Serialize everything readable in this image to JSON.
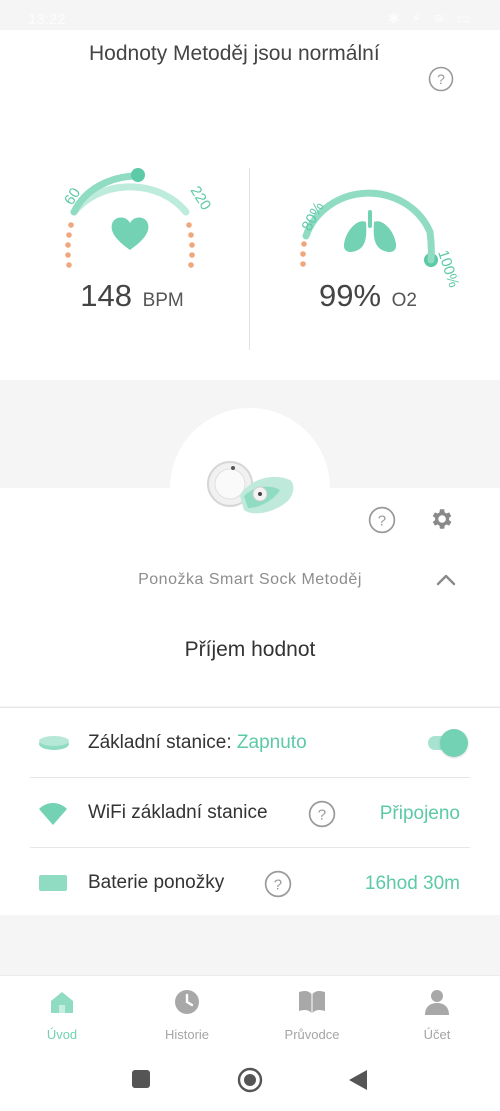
{
  "status_bar": {
    "time": "13:22",
    "icons": "✱ ⚡ ≋ ▭"
  },
  "summary": {
    "headline": "Hodnoty Metoděj jsou normální"
  },
  "heart_gauge": {
    "min_label": "60",
    "max_label": "220",
    "value": "148",
    "unit": "BPM",
    "level_fraction": 0.55
  },
  "oxygen_gauge": {
    "min_label": "80%",
    "max_label": "100%",
    "value": "99%",
    "unit": "O2",
    "level_fraction": 0.95
  },
  "device": {
    "name": "Ponožka Smart Sock Metoděj",
    "status": "Příjem hodnot"
  },
  "rows": {
    "base_station": {
      "label": "Základní stanice:",
      "value": "Zapnuto",
      "toggle_on": true
    },
    "wifi": {
      "label": "WiFi základní stanice",
      "value": "Připojeno"
    },
    "battery": {
      "label": "Baterie ponožky",
      "value": "16hod 30m"
    }
  },
  "nav": {
    "home": "Úvod",
    "history": "Historie",
    "guide": "Průvodce",
    "account": "Účet"
  },
  "colors": {
    "accent": "#72d2b3",
    "accent_text": "#5cc9a7",
    "warning_dots": "#f0a77e"
  },
  "icons": [
    "help-icon",
    "heart-icon",
    "lungs-icon",
    "gear-icon",
    "chevron-up-icon",
    "base-station-icon",
    "wifi-icon",
    "battery-icon",
    "home-icon",
    "clock-icon",
    "book-icon",
    "person-icon"
  ]
}
